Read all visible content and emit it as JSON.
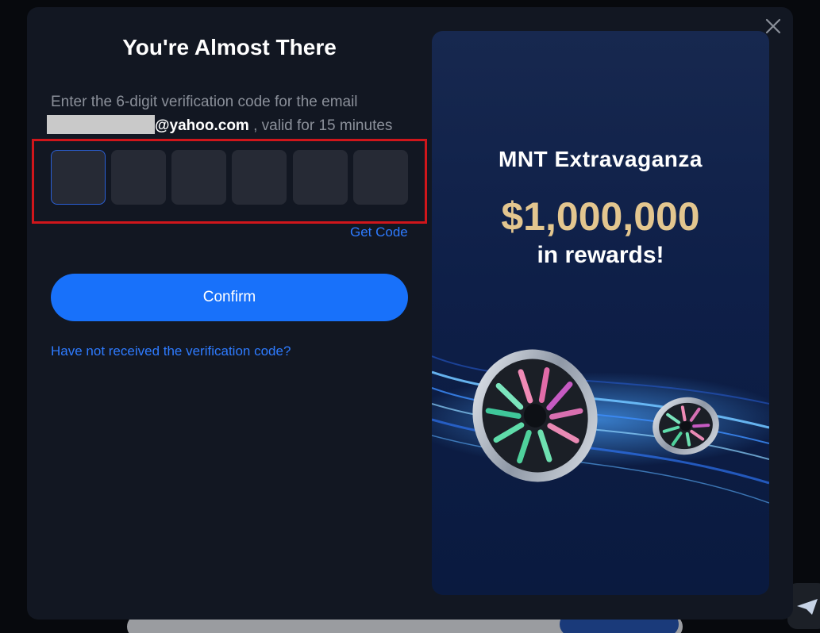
{
  "modal": {
    "title": "You're Almost There",
    "description_line1": "Enter the 6-digit verification code for the email",
    "email_domain": "@yahoo.com",
    "description_line2": " , valid for 15 minutes",
    "code_digits": 6,
    "get_code_label": "Get Code",
    "confirm_label": "Confirm",
    "not_received_label": "Have not received the verification code?"
  },
  "promo": {
    "title": "MNT Extravaganza",
    "amount": "$1,000,000",
    "subtitle": "in rewards!"
  },
  "icons": {
    "close": "close-icon",
    "annotation": "red-arrow-left-icon",
    "send": "send-icon"
  },
  "colors": {
    "accent": "#1871fa",
    "link": "#2e7bff",
    "highlight": "#d0161b",
    "amount_gold": "#e3c68f"
  }
}
